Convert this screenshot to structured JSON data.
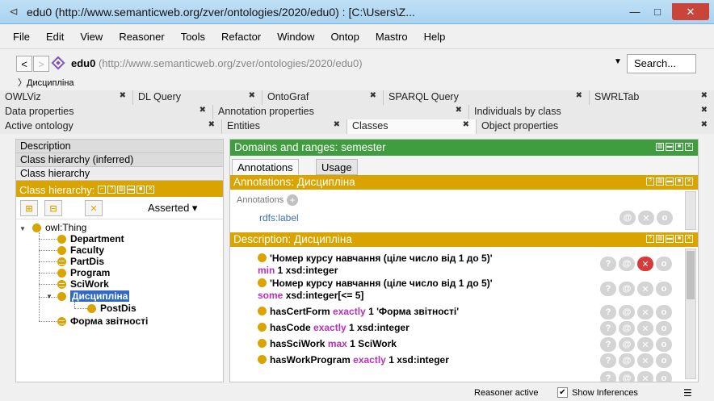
{
  "window": {
    "title": "edu0 (http://www.semanticweb.org/zver/ontologies/2020/edu0)  : [C:\\Users\\Z...",
    "minimize": "—",
    "maximize": "□",
    "close": "✕"
  },
  "menu": [
    "File",
    "Edit",
    "View",
    "Reasoner",
    "Tools",
    "Refactor",
    "Window",
    "Ontop",
    "Mastro",
    "Help"
  ],
  "address": {
    "back": "<",
    "forward": ">",
    "ontology_name": "edu0",
    "ontology_iri": "(http://www.semanticweb.org/zver/ontologies/2020/edu0)",
    "search_placeholder": "Search...",
    "breadcrumb": "Дисципліна"
  },
  "tab_rows": [
    [
      {
        "label": "OWLViz",
        "width": 165
      },
      {
        "label": "DL Query",
        "width": 160
      },
      {
        "label": "OntoGraf",
        "width": 150
      },
      {
        "label": "SPARQL Query",
        "width": 255
      },
      {
        "label": "SWRLTab",
        "width": 154
      }
    ],
    [
      {
        "label": "Data properties",
        "width": 264
      },
      {
        "label": "Annotation properties",
        "width": 317
      },
      {
        "label": "Individuals by class",
        "width": 303
      }
    ],
    [
      {
        "label": "Active ontology",
        "width": 275
      },
      {
        "label": "Entities",
        "width": 155
      },
      {
        "label": "Classes",
        "width": 160,
        "active": true
      },
      {
        "label": "Object properties",
        "width": 294
      }
    ]
  ],
  "left": {
    "view_tabs": [
      "Description",
      "Class hierarchy (inferred)",
      "Class hierarchy"
    ],
    "header": "Class hierarchy:",
    "asserted": "Asserted ▾",
    "tree": {
      "root": "owl:Thing",
      "children": [
        "Department",
        "Faculty",
        "PartDis",
        "Program",
        "SciWork",
        "Дисципліна",
        "PostDis",
        "Форма звітності"
      ]
    }
  },
  "right": {
    "domains_header": "Domains and ranges: semester",
    "subtabs": [
      "Annotations",
      "Usage"
    ],
    "annotations_header": "Annotations: Дисципліна",
    "annotations_label": "Annotations",
    "rdfs_label": "rdfs:label",
    "description_header": "Description: Дисципліна",
    "axioms": [
      {
        "l1": "'Номер курсу навчання (ціле число від 1 до 5)'",
        "kw": "min",
        "rest": " 1 xsd:integer"
      },
      {
        "l1": "'Номер курсу навчання (ціле число від 1 до 5)'",
        "kw": "some",
        "rest": " xsd:integer[<= 5]"
      },
      {
        "pre": "hasCertForm ",
        "kw": "exactly",
        "rest": " 1 'Форма звітності'"
      },
      {
        "pre": "hasCode ",
        "kw": "exactly",
        "rest": " 1 xsd:integer"
      },
      {
        "pre": "hasSciWork ",
        "kw": "max",
        "rest": " 1 SciWork"
      },
      {
        "pre": "hasWorkProgram ",
        "kw": "exactly",
        "rest": " 1 xsd:integer"
      }
    ]
  },
  "status": {
    "reasoner": "Reasoner active",
    "show_inferences": "Show Inferences"
  },
  "colors": {
    "class_yellow": "#d9a400",
    "green_header": "#3f9d3f",
    "keyword_purple": "#b532b8",
    "selection_blue": "#316ac5"
  }
}
